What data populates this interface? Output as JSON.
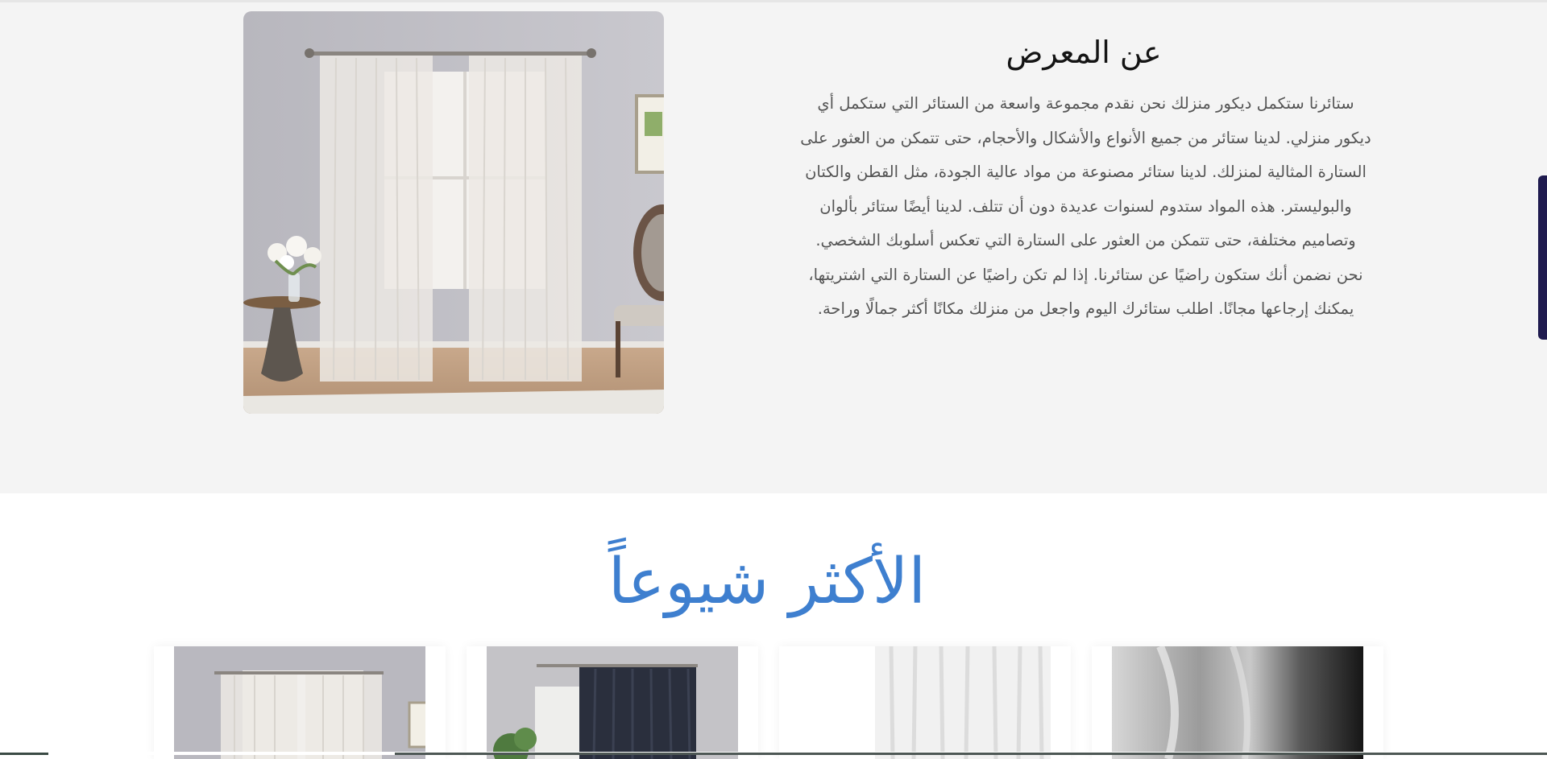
{
  "about": {
    "title": "عن المعرض",
    "paragraph_lines": [
      "ستائرنا ستكمل ديكور منزلك نحن نقدم مجموعة واسعة من الستائر التي ستكمل أي",
      "ديكور منزلي. لدينا ستائر من جميع الأنواع والأشكال والأحجام، حتى تتمكن من العثور على",
      "الستارة المثالية لمنزلك. لدينا ستائر مصنوعة من مواد عالية الجودة، مثل القطن والكتان",
      "والبوليستر. هذه المواد ستدوم لسنوات عديدة دون أن تتلف. لدينا أيضًا ستائر بألوان",
      "وتصاميم مختلفة، حتى تتمكن من العثور على الستارة التي تعكس أسلوبك الشخصي.",
      "نحن نضمن أنك ستكون راضيًا عن ستائرنا. إذا لم تكن راضيًا عن الستارة التي اشتريتها،",
      "يمكنك إرجاعها مجانًا. اطلب ستائرك اليوم واجعل من منزلك مكانًا أكثر جمالًا وراحة."
    ],
    "image_icon": "sheer-curtain-room-photo"
  },
  "popular": {
    "title": "الأكثر شيوعاً",
    "products": [
      {
        "icon": "sheer-white-curtain-photo"
      },
      {
        "icon": "dark-navy-blackout-curtain-photo"
      },
      {
        "icon": "white-voile-curtain-photo"
      },
      {
        "icon": "grey-linen-curtain-photo"
      }
    ]
  },
  "colors": {
    "accent_title": "#3e7fcf",
    "section_bg": "#f4f4f4",
    "scrollbar": "#1f1b4f"
  }
}
